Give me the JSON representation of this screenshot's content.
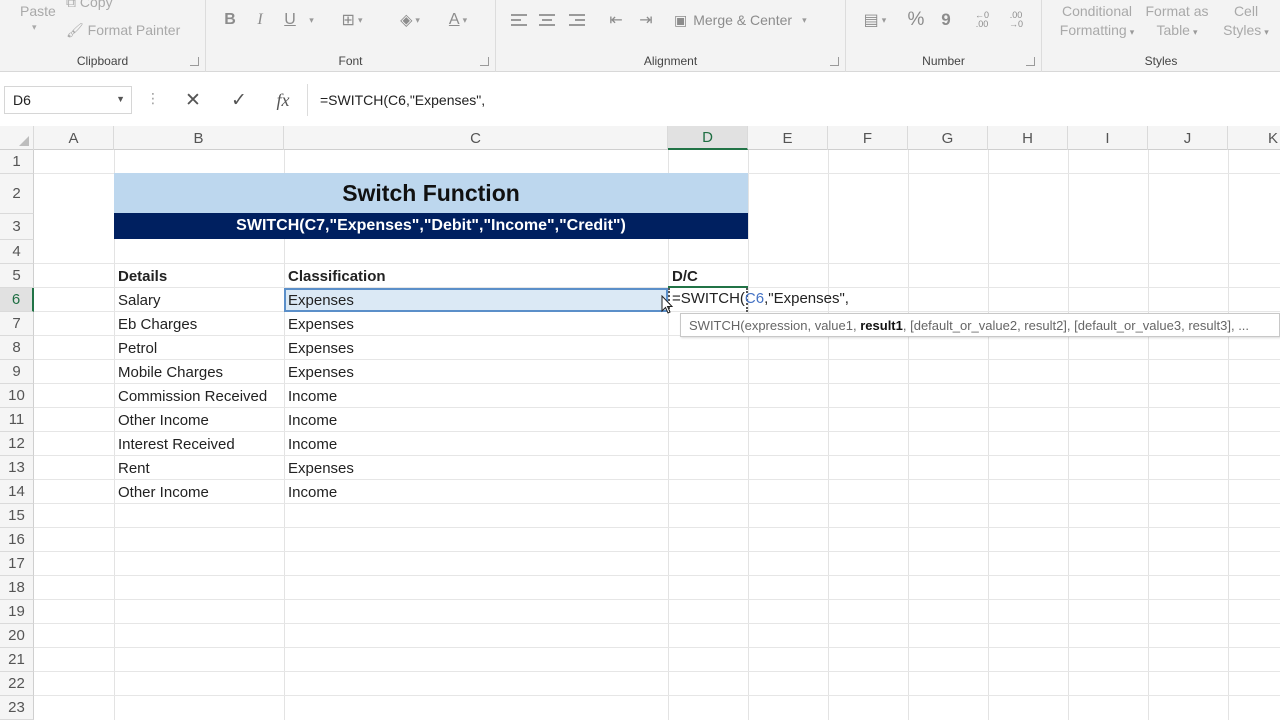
{
  "ribbon": {
    "clipboard": {
      "label": "Clipboard",
      "paste": "Paste",
      "copy": "Copy",
      "format_painter": "Format Painter"
    },
    "font": {
      "label": "Font",
      "bold": "B",
      "italic": "I",
      "underline": "U"
    },
    "alignment": {
      "label": "Alignment",
      "merge_center": "Merge & Center"
    },
    "number": {
      "label": "Number",
      "percent": "%",
      "comma": "9",
      "inc_decimal": "←0 .00",
      "dec_decimal": ".00 →0"
    },
    "styles": {
      "label": "Styles",
      "conditional_formatting": "Conditional Formatting",
      "format_as_table": "Format as Table",
      "cell_styles": "Cell Styles"
    }
  },
  "formula_bar": {
    "name_box": "D6",
    "cancel": "✕",
    "enter": "✓",
    "fx": "fx",
    "formula": "=SWITCH(C6,\"Expenses\","
  },
  "columns": [
    "A",
    "B",
    "C",
    "D",
    "E",
    "F",
    "G",
    "H",
    "I",
    "J",
    "K"
  ],
  "active_column": "D",
  "rows": [
    "1",
    "2",
    "3",
    "4",
    "5",
    "6",
    "7",
    "8",
    "9",
    "10",
    "11",
    "12",
    "13",
    "14",
    "15",
    "16",
    "17",
    "18",
    "19",
    "20",
    "21",
    "22",
    "23"
  ],
  "active_row": "6",
  "sheet": {
    "title": "Switch Function",
    "formula_banner": "SWITCH(C7,\"Expenses\",\"Debit\",\"Income\",\"Credit\")",
    "headers": {
      "details": "Details",
      "classification": "Classification",
      "dc": "D/C"
    },
    "records": [
      {
        "details": "Salary",
        "classification": "Expenses"
      },
      {
        "details": "Eb Charges",
        "classification": "Expenses"
      },
      {
        "details": "Petrol",
        "classification": "Expenses"
      },
      {
        "details": "Mobile Charges",
        "classification": "Expenses"
      },
      {
        "details": "Commission Received",
        "classification": "Income"
      },
      {
        "details": "Other Income",
        "classification": "Income"
      },
      {
        "details": "Interest Received",
        "classification": "Income"
      },
      {
        "details": "Rent",
        "classification": "Expenses"
      },
      {
        "details": "Other Income",
        "classification": "Income"
      }
    ],
    "editing": {
      "prefix": "=SWITCH(",
      "ref": "C6",
      "suffix": ",\"Expenses\","
    },
    "tooltip": {
      "pre": "SWITCH(expression, value1, ",
      "bold": "result1",
      "post": ", [default_or_value2, result2], [default_or_value3, result3], ..."
    }
  },
  "colors": {
    "title_band": "#bdd7ee",
    "formula_band": "#002060",
    "excel_green": "#217346",
    "selection": "#dbe9f5"
  }
}
